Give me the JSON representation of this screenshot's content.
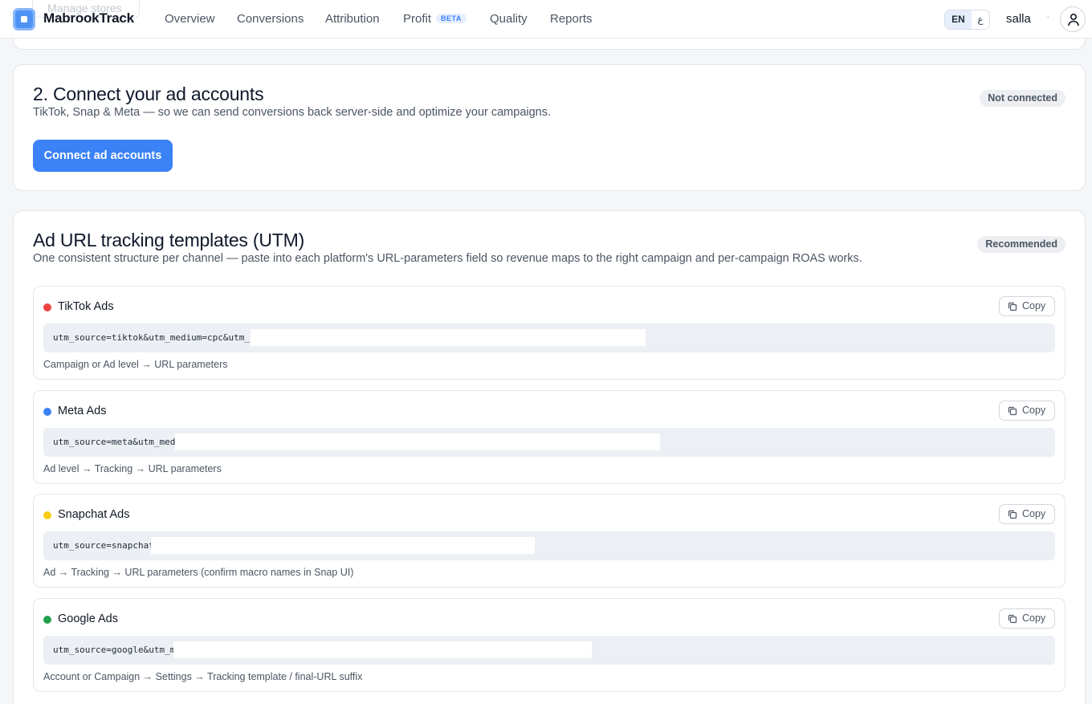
{
  "header": {
    "ghost_button": "Manage stores",
    "brand": "MabrookTrack",
    "nav": [
      {
        "label": "Overview"
      },
      {
        "label": "Conversions"
      },
      {
        "label": "Attribution"
      },
      {
        "label": "Profit",
        "badge": "BETA"
      },
      {
        "label": "Quality"
      },
      {
        "label": "Reports"
      }
    ],
    "lang_en": "EN",
    "lang_ar": "ع",
    "store": "salla",
    "separator": "·",
    "icons": {
      "logo": "logo-icon",
      "account": "user-icon"
    }
  },
  "connect_card": {
    "title": "2. Connect your ad accounts",
    "subtitle": "TikTok, Snap & Meta — so we can send conversions back server-side and optimize your campaigns.",
    "status": "Not connected",
    "button": "Connect ad accounts"
  },
  "utm_card": {
    "title": "Ad URL tracking templates (UTM)",
    "subtitle": "One consistent structure per channel — paste into each platform's URL-parameters field so revenue maps to the right campaign and per-campaign ROAS works.",
    "status": "Recommended",
    "copy_label": "Copy",
    "items": [
      {
        "name": "TikTok Ads",
        "color": "#ef4444",
        "code": "utm_source=tiktok&utm_medium=cpc&utm_",
        "hint": "Campaign or Ad level → URL parameters"
      },
      {
        "name": "Meta Ads",
        "color": "#3b82f6",
        "code": "utm_source=meta&utm_med",
        "hint": "Ad level → Tracking → URL parameters"
      },
      {
        "name": "Snapchat Ads",
        "color": "#facc15",
        "code": "utm_source=snapchat",
        "hint": "Ad → Tracking → URL parameters (confirm macro names in Snap UI)"
      },
      {
        "name": "Google Ads",
        "color": "#22a04b",
        "code": "utm_source=google&utm_m",
        "hint": "Account or Campaign → Settings → Tracking template / final-URL suffix"
      }
    ]
  },
  "colors": {
    "primary": "#3b82f6",
    "pill_bg": "#eceef1"
  }
}
